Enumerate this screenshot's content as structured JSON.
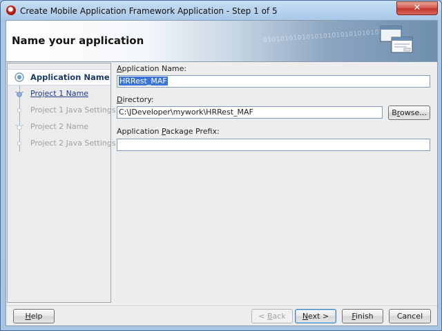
{
  "window": {
    "title": "Create Mobile Application Framework Application - Step 1 of 5",
    "close_symbol": "✕"
  },
  "banner": {
    "title": "Name your application",
    "decoration": "0101010101010101010101010101"
  },
  "steps": [
    {
      "label": "Application Name",
      "state": "current"
    },
    {
      "label": "Project 1 Name",
      "state": "link"
    },
    {
      "label": "Project 1 Java Settings",
      "state": "disabled"
    },
    {
      "label": "Project 2 Name",
      "state": "disabled"
    },
    {
      "label": "Project 2 Java Settings",
      "state": "disabled"
    }
  ],
  "form": {
    "app_name_label": {
      "pre": "",
      "key": "A",
      "post": "pplication Name:"
    },
    "app_name_value": "HRRest_MAF",
    "directory_label": {
      "pre": "",
      "key": "D",
      "post": "irectory:"
    },
    "directory_value": "C:\\JDeveloper\\mywork\\HRRest_MAF",
    "browse_label": {
      "pre": "B",
      "key": "r",
      "post": "owse..."
    },
    "package_label": {
      "pre": "Application ",
      "key": "P",
      "post": "ackage Prefix:"
    },
    "package_value": ""
  },
  "buttons": {
    "help": {
      "pre": "",
      "key": "H",
      "post": "elp"
    },
    "back": {
      "pre": "< ",
      "key": "B",
      "post": "ack"
    },
    "next": {
      "pre": "",
      "key": "N",
      "post": "ext >"
    },
    "finish": {
      "pre": "",
      "key": "F",
      "post": "inish"
    },
    "cancel": {
      "pre": "Cancel",
      "key": "",
      "post": ""
    }
  },
  "colors": {
    "selection": "#3875d7",
    "link": "#1d3b8f",
    "accent": "#4a6c93"
  }
}
